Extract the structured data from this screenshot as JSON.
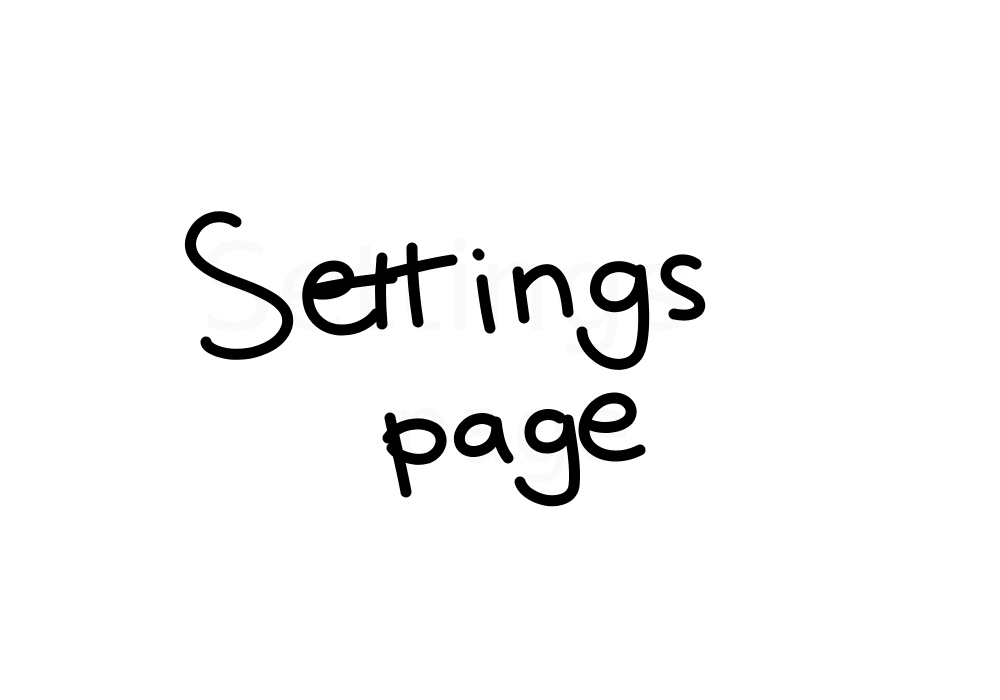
{
  "note": {
    "line_1": "Settings",
    "line_2": "page"
  },
  "colors": {
    "background": "#ffffff",
    "ink": "#000000"
  }
}
